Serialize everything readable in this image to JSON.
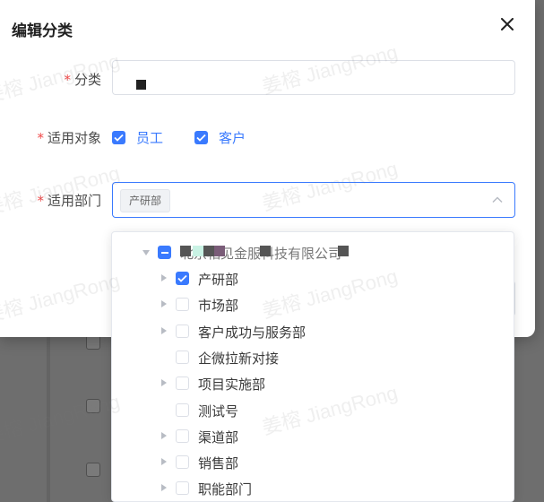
{
  "modal": {
    "title": "编辑分类",
    "close_icon": "close-icon"
  },
  "form": {
    "category": {
      "label": "分类",
      "required_mark": "*",
      "value": "ㅤ"
    },
    "applicable_objects": {
      "label": "适用对象",
      "required_mark": "*",
      "options": [
        {
          "label": "员工",
          "checked": true
        },
        {
          "label": "客户",
          "checked": true
        }
      ]
    },
    "applicable_departments": {
      "label": "适用部门",
      "required_mark": "*",
      "selected_tags": [
        "产研部"
      ],
      "arrow_icon": "chevron-up-icon"
    }
  },
  "tree": {
    "root": {
      "label": "北京相见金服科技有限公司",
      "state": "indeterminate",
      "expanded": true
    },
    "children": [
      {
        "label": "产研部",
        "checked": true,
        "has_children": true
      },
      {
        "label": "市场部",
        "checked": false,
        "has_children": true
      },
      {
        "label": "客户成功与服务部",
        "checked": false,
        "has_children": true
      },
      {
        "label": "企微拉新对接",
        "checked": false,
        "has_children": false
      },
      {
        "label": "项目实施部",
        "checked": false,
        "has_children": true
      },
      {
        "label": "测试号",
        "checked": false,
        "has_children": false
      },
      {
        "label": "渠道部",
        "checked": false,
        "has_children": true
      },
      {
        "label": "销售部",
        "checked": false,
        "has_children": true
      },
      {
        "label": "职能部门",
        "checked": false,
        "has_children": true
      }
    ]
  },
  "watermark": {
    "text": "姜榕 JiangRong"
  },
  "colors": {
    "primary": "#3a7afe",
    "required": "#f04848",
    "overlay": "#6e6e6e"
  }
}
